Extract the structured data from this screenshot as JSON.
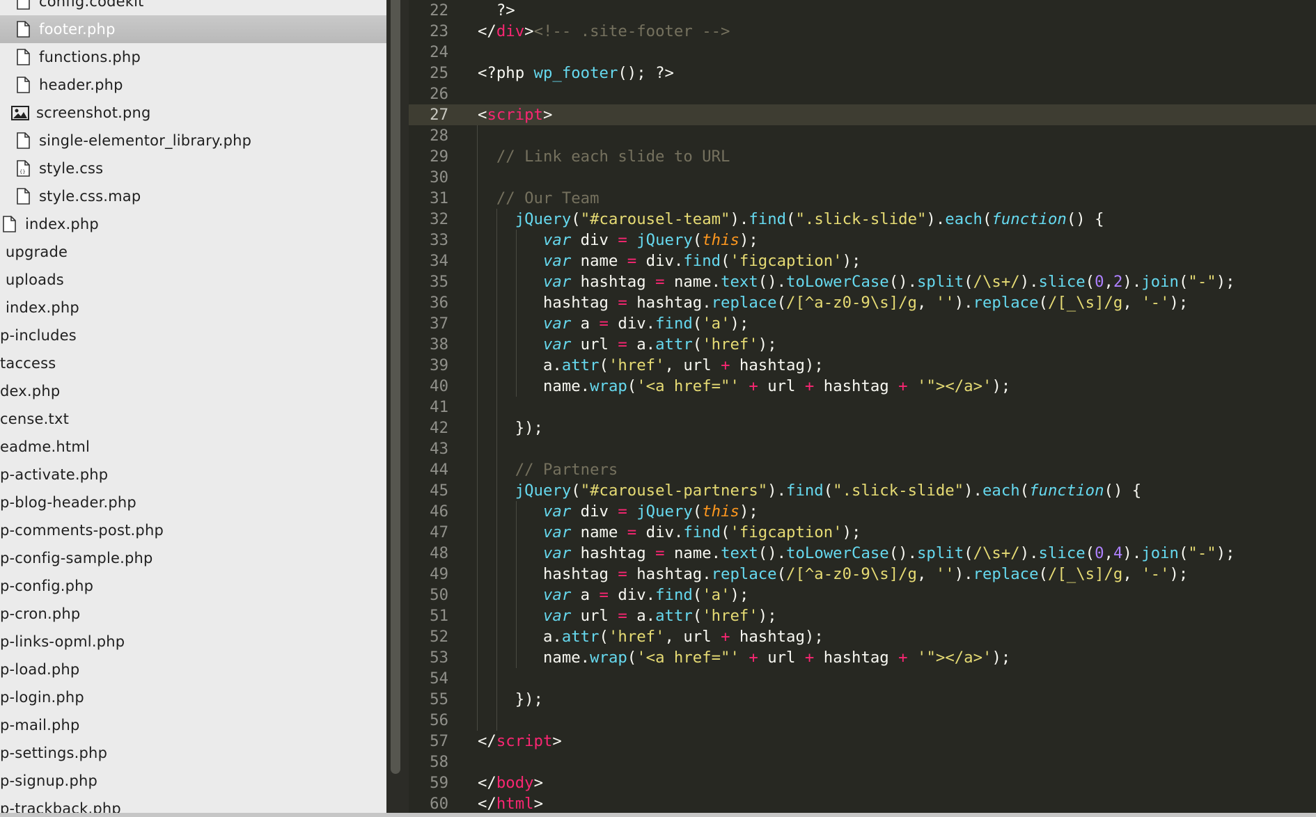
{
  "sidebar": {
    "items": [
      {
        "label": "config.codekit",
        "icon": "file-icon"
      },
      {
        "label": "footer.php",
        "icon": "file-icon",
        "selected": true
      },
      {
        "label": "functions.php",
        "icon": "file-icon"
      },
      {
        "label": "header.php",
        "icon": "file-icon"
      },
      {
        "label": "screenshot.png",
        "icon": "image-file-icon"
      },
      {
        "label": "single-elementor_library.php",
        "icon": "file-icon"
      },
      {
        "label": "style.css",
        "icon": "css-file-icon"
      },
      {
        "label": "style.css.map",
        "icon": "file-icon"
      },
      {
        "label": "index.php",
        "icon": "file-icon"
      },
      {
        "label": "upgrade",
        "icon": ""
      },
      {
        "label": "uploads",
        "icon": ""
      },
      {
        "label": "index.php",
        "icon": ""
      },
      {
        "label": "p-includes",
        "icon": ""
      },
      {
        "label": "taccess",
        "icon": ""
      },
      {
        "label": "dex.php",
        "icon": ""
      },
      {
        "label": "cense.txt",
        "icon": ""
      },
      {
        "label": "eadme.html",
        "icon": ""
      },
      {
        "label": "p-activate.php",
        "icon": ""
      },
      {
        "label": "p-blog-header.php",
        "icon": ""
      },
      {
        "label": "p-comments-post.php",
        "icon": ""
      },
      {
        "label": "p-config-sample.php",
        "icon": ""
      },
      {
        "label": "p-config.php",
        "icon": ""
      },
      {
        "label": "p-cron.php",
        "icon": ""
      },
      {
        "label": "p-links-opml.php",
        "icon": ""
      },
      {
        "label": "p-load.php",
        "icon": ""
      },
      {
        "label": "p-login.php",
        "icon": ""
      },
      {
        "label": "p-mail.php",
        "icon": ""
      },
      {
        "label": "p-settings.php",
        "icon": ""
      },
      {
        "label": "p-signup.php",
        "icon": ""
      },
      {
        "label": "p-trackback.php",
        "icon": ""
      }
    ]
  },
  "editor": {
    "active_line": "27",
    "lines": [
      {
        "n": "22",
        "tokens": [
          [
            "  ?>",
            ""
          ]
        ]
      },
      {
        "n": "23",
        "tokens": [
          [
            "</",
            ""
          ],
          [
            "div",
            "tg"
          ],
          [
            ">",
            ""
          ],
          [
            "<!-- .site-footer -->",
            "cm"
          ]
        ]
      },
      {
        "n": "24",
        "tokens": []
      },
      {
        "n": "25",
        "tokens": [
          [
            "<?php ",
            ""
          ],
          [
            "wp_footer",
            "fn"
          ],
          [
            "(); ?>",
            ""
          ]
        ]
      },
      {
        "n": "26",
        "tokens": []
      },
      {
        "n": "27",
        "tokens": [
          [
            "<",
            ""
          ],
          [
            "script",
            "tg"
          ],
          [
            ">",
            ""
          ]
        ]
      },
      {
        "n": "28",
        "tokens": []
      },
      {
        "n": "29",
        "tokens": [
          [
            "  // Link each slide to URL",
            "cm"
          ]
        ]
      },
      {
        "n": "30",
        "tokens": []
      },
      {
        "n": "31",
        "tokens": [
          [
            "  // Our Team",
            "cm"
          ]
        ]
      },
      {
        "n": "32",
        "tokens": [
          [
            "    ",
            ""
          ],
          [
            "jQuery",
            "fn"
          ],
          [
            "(",
            ""
          ],
          [
            "\"#carousel-team\"",
            "st"
          ],
          [
            ").",
            ""
          ],
          [
            "find",
            "fn"
          ],
          [
            "(",
            ""
          ],
          [
            "\".slick-slide\"",
            "st"
          ],
          [
            ").",
            ""
          ],
          [
            "each",
            "fn"
          ],
          [
            "(",
            ""
          ],
          [
            "function",
            "kw"
          ],
          [
            "() {",
            ""
          ]
        ]
      },
      {
        "n": "33",
        "tokens": [
          [
            "       ",
            ""
          ],
          [
            "var",
            "kw"
          ],
          [
            " div ",
            ""
          ],
          [
            "=",
            "op"
          ],
          [
            " ",
            ""
          ],
          [
            "jQuery",
            "fn"
          ],
          [
            "(",
            ""
          ],
          [
            "this",
            "th"
          ],
          [
            ");",
            ""
          ]
        ]
      },
      {
        "n": "34",
        "tokens": [
          [
            "       ",
            ""
          ],
          [
            "var",
            "kw"
          ],
          [
            " name ",
            ""
          ],
          [
            "=",
            "op"
          ],
          [
            " div.",
            ""
          ],
          [
            "find",
            "fn"
          ],
          [
            "(",
            ""
          ],
          [
            "'figcaption'",
            "st"
          ],
          [
            ");",
            ""
          ]
        ]
      },
      {
        "n": "35",
        "tokens": [
          [
            "       ",
            ""
          ],
          [
            "var",
            "kw"
          ],
          [
            " hashtag ",
            ""
          ],
          [
            "=",
            "op"
          ],
          [
            " name.",
            ""
          ],
          [
            "text",
            "fn"
          ],
          [
            "().",
            ""
          ],
          [
            "toLowerCase",
            "fn"
          ],
          [
            "().",
            ""
          ],
          [
            "split",
            "fn"
          ],
          [
            "(",
            ""
          ],
          [
            "/\\s+/",
            "st"
          ],
          [
            ").",
            ""
          ],
          [
            "slice",
            "fn"
          ],
          [
            "(",
            ""
          ],
          [
            "0",
            "nm"
          ],
          [
            ",",
            ""
          ],
          [
            "2",
            "nm"
          ],
          [
            ").",
            ""
          ],
          [
            "join",
            "fn"
          ],
          [
            "(",
            ""
          ],
          [
            "\"-\"",
            "st"
          ],
          [
            ");",
            ""
          ]
        ]
      },
      {
        "n": "36",
        "tokens": [
          [
            "       hashtag ",
            ""
          ],
          [
            "=",
            "op"
          ],
          [
            " hashtag.",
            ""
          ],
          [
            "replace",
            "fn"
          ],
          [
            "(",
            ""
          ],
          [
            "/[^a-z0-9\\s]/g",
            "st"
          ],
          [
            ", ",
            ""
          ],
          [
            "''",
            "st"
          ],
          [
            ").",
            ""
          ],
          [
            "replace",
            "fn"
          ],
          [
            "(",
            ""
          ],
          [
            "/[_\\s]/g",
            "st"
          ],
          [
            ", ",
            ""
          ],
          [
            "'-'",
            "st"
          ],
          [
            ");",
            ""
          ]
        ]
      },
      {
        "n": "37",
        "tokens": [
          [
            "       ",
            ""
          ],
          [
            "var",
            "kw"
          ],
          [
            " a ",
            ""
          ],
          [
            "=",
            "op"
          ],
          [
            " div.",
            ""
          ],
          [
            "find",
            "fn"
          ],
          [
            "(",
            ""
          ],
          [
            "'a'",
            "st"
          ],
          [
            ");",
            ""
          ]
        ]
      },
      {
        "n": "38",
        "tokens": [
          [
            "       ",
            ""
          ],
          [
            "var",
            "kw"
          ],
          [
            " url ",
            ""
          ],
          [
            "=",
            "op"
          ],
          [
            " a.",
            ""
          ],
          [
            "attr",
            "fn"
          ],
          [
            "(",
            ""
          ],
          [
            "'href'",
            "st"
          ],
          [
            ");",
            ""
          ]
        ]
      },
      {
        "n": "39",
        "tokens": [
          [
            "       a.",
            ""
          ],
          [
            "attr",
            "fn"
          ],
          [
            "(",
            ""
          ],
          [
            "'href'",
            "st"
          ],
          [
            ", url ",
            ""
          ],
          [
            "+",
            "op"
          ],
          [
            " hashtag);",
            ""
          ]
        ]
      },
      {
        "n": "40",
        "tokens": [
          [
            "       name.",
            ""
          ],
          [
            "wrap",
            "fn"
          ],
          [
            "(",
            ""
          ],
          [
            "'<a href=\"'",
            "st"
          ],
          [
            " ",
            ""
          ],
          [
            "+",
            "op"
          ],
          [
            " url ",
            ""
          ],
          [
            "+",
            "op"
          ],
          [
            " hashtag ",
            ""
          ],
          [
            "+",
            "op"
          ],
          [
            " ",
            ""
          ],
          [
            "'\"></a>'",
            "st"
          ],
          [
            ");",
            ""
          ]
        ]
      },
      {
        "n": "41",
        "tokens": []
      },
      {
        "n": "42",
        "tokens": [
          [
            "    });",
            ""
          ]
        ]
      },
      {
        "n": "43",
        "tokens": []
      },
      {
        "n": "44",
        "tokens": [
          [
            "    // Partners",
            "cm"
          ]
        ]
      },
      {
        "n": "45",
        "tokens": [
          [
            "    ",
            ""
          ],
          [
            "jQuery",
            "fn"
          ],
          [
            "(",
            ""
          ],
          [
            "\"#carousel-partners\"",
            "st"
          ],
          [
            ").",
            ""
          ],
          [
            "find",
            "fn"
          ],
          [
            "(",
            ""
          ],
          [
            "\".slick-slide\"",
            "st"
          ],
          [
            ").",
            ""
          ],
          [
            "each",
            "fn"
          ],
          [
            "(",
            ""
          ],
          [
            "function",
            "kw"
          ],
          [
            "() {",
            ""
          ]
        ]
      },
      {
        "n": "46",
        "tokens": [
          [
            "       ",
            ""
          ],
          [
            "var",
            "kw"
          ],
          [
            " div ",
            ""
          ],
          [
            "=",
            "op"
          ],
          [
            " ",
            ""
          ],
          [
            "jQuery",
            "fn"
          ],
          [
            "(",
            ""
          ],
          [
            "this",
            "th"
          ],
          [
            ");",
            ""
          ]
        ]
      },
      {
        "n": "47",
        "tokens": [
          [
            "       ",
            ""
          ],
          [
            "var",
            "kw"
          ],
          [
            " name ",
            ""
          ],
          [
            "=",
            "op"
          ],
          [
            " div.",
            ""
          ],
          [
            "find",
            "fn"
          ],
          [
            "(",
            ""
          ],
          [
            "'figcaption'",
            "st"
          ],
          [
            ");",
            ""
          ]
        ]
      },
      {
        "n": "48",
        "tokens": [
          [
            "       ",
            ""
          ],
          [
            "var",
            "kw"
          ],
          [
            " hashtag ",
            ""
          ],
          [
            "=",
            "op"
          ],
          [
            " name.",
            ""
          ],
          [
            "text",
            "fn"
          ],
          [
            "().",
            ""
          ],
          [
            "toLowerCase",
            "fn"
          ],
          [
            "().",
            ""
          ],
          [
            "split",
            "fn"
          ],
          [
            "(",
            ""
          ],
          [
            "/\\s+/",
            "st"
          ],
          [
            ").",
            ""
          ],
          [
            "slice",
            "fn"
          ],
          [
            "(",
            ""
          ],
          [
            "0",
            "nm"
          ],
          [
            ",",
            ""
          ],
          [
            "4",
            "nm"
          ],
          [
            ").",
            ""
          ],
          [
            "join",
            "fn"
          ],
          [
            "(",
            ""
          ],
          [
            "\"-\"",
            "st"
          ],
          [
            ");",
            ""
          ]
        ]
      },
      {
        "n": "49",
        "tokens": [
          [
            "       hashtag ",
            ""
          ],
          [
            "=",
            "op"
          ],
          [
            " hashtag.",
            ""
          ],
          [
            "replace",
            "fn"
          ],
          [
            "(",
            ""
          ],
          [
            "/[^a-z0-9\\s]/g",
            "st"
          ],
          [
            ", ",
            ""
          ],
          [
            "''",
            "st"
          ],
          [
            ").",
            ""
          ],
          [
            "replace",
            "fn"
          ],
          [
            "(",
            ""
          ],
          [
            "/[_\\s]/g",
            "st"
          ],
          [
            ", ",
            ""
          ],
          [
            "'-'",
            "st"
          ],
          [
            ");",
            ""
          ]
        ]
      },
      {
        "n": "50",
        "tokens": [
          [
            "       ",
            ""
          ],
          [
            "var",
            "kw"
          ],
          [
            " a ",
            ""
          ],
          [
            "=",
            "op"
          ],
          [
            " div.",
            ""
          ],
          [
            "find",
            "fn"
          ],
          [
            "(",
            ""
          ],
          [
            "'a'",
            "st"
          ],
          [
            ");",
            ""
          ]
        ]
      },
      {
        "n": "51",
        "tokens": [
          [
            "       ",
            ""
          ],
          [
            "var",
            "kw"
          ],
          [
            " url ",
            ""
          ],
          [
            "=",
            "op"
          ],
          [
            " a.",
            ""
          ],
          [
            "attr",
            "fn"
          ],
          [
            "(",
            ""
          ],
          [
            "'href'",
            "st"
          ],
          [
            ");",
            ""
          ]
        ]
      },
      {
        "n": "52",
        "tokens": [
          [
            "       a.",
            ""
          ],
          [
            "attr",
            "fn"
          ],
          [
            "(",
            ""
          ],
          [
            "'href'",
            "st"
          ],
          [
            ", url ",
            ""
          ],
          [
            "+",
            "op"
          ],
          [
            " hashtag);",
            ""
          ]
        ]
      },
      {
        "n": "53",
        "tokens": [
          [
            "       name.",
            ""
          ],
          [
            "wrap",
            "fn"
          ],
          [
            "(",
            ""
          ],
          [
            "'<a href=\"'",
            "st"
          ],
          [
            " ",
            ""
          ],
          [
            "+",
            "op"
          ],
          [
            " url ",
            ""
          ],
          [
            "+",
            "op"
          ],
          [
            " hashtag ",
            ""
          ],
          [
            "+",
            "op"
          ],
          [
            " ",
            ""
          ],
          [
            "'\"></a>'",
            "st"
          ],
          [
            ");",
            ""
          ]
        ]
      },
      {
        "n": "54",
        "tokens": []
      },
      {
        "n": "55",
        "tokens": [
          [
            "    });",
            ""
          ]
        ]
      },
      {
        "n": "56",
        "tokens": []
      },
      {
        "n": "57",
        "tokens": [
          [
            "</",
            ""
          ],
          [
            "script",
            "tg"
          ],
          [
            ">",
            ""
          ]
        ]
      },
      {
        "n": "58",
        "tokens": []
      },
      {
        "n": "59",
        "tokens": [
          [
            "</",
            ""
          ],
          [
            "body",
            "tg"
          ],
          [
            ">",
            ""
          ]
        ]
      },
      {
        "n": "60",
        "tokens": [
          [
            "</",
            ""
          ],
          [
            "html",
            "tg"
          ],
          [
            ">",
            ""
          ]
        ]
      }
    ]
  },
  "colors": {
    "editor_bg": "#272822",
    "sidebar_bg": "#ebebeb",
    "tag": "#f92672",
    "function": "#66d9ef",
    "string": "#e6db74",
    "comment": "#75715e",
    "number": "#ae81ff"
  }
}
